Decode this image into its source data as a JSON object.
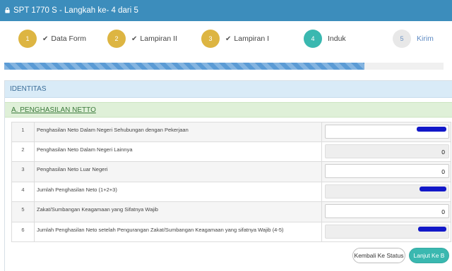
{
  "window": {
    "title": "SPT 1770 S - Langkah ke- 4 dari 5",
    "lock_icon": "lock-icon"
  },
  "steps": [
    {
      "number": "1",
      "label": "Data Form",
      "status": "done"
    },
    {
      "number": "2",
      "label": "Lampiran II",
      "status": "done"
    },
    {
      "number": "3",
      "label": "Lampiran I",
      "status": "done"
    },
    {
      "number": "4",
      "label": "Induk",
      "status": "active"
    },
    {
      "number": "5",
      "label": "Kirim",
      "status": "pending"
    }
  ],
  "step_check_glyph": "✔",
  "progress": {
    "percent": 82,
    "color": "#5b9bd5"
  },
  "panel": {
    "title": "IDENTITAS"
  },
  "section": {
    "title": "A. PENGHASILAN NETTO"
  },
  "rows": [
    {
      "num": "1",
      "label": "Penghasilan Neto Dalam Negeri Sehubungan dengan Pekerjaan",
      "value": "",
      "readonly": false,
      "redacted": true
    },
    {
      "num": "2",
      "label": "Penghasilan Neto Dalam Negeri Lainnya",
      "value": "0",
      "readonly": true,
      "redacted": false
    },
    {
      "num": "3",
      "label": "Penghasilan Neto Luar Negeri",
      "value": "0",
      "readonly": false,
      "redacted": false
    },
    {
      "num": "4",
      "label": "Jumlah Penghasilan Neto (1+2+3)",
      "value": "",
      "readonly": true,
      "redacted": true
    },
    {
      "num": "5",
      "label": "Zakat/Sumbangan Keagamaan yang Sifatnya Wajib",
      "value": "0",
      "readonly": false,
      "redacted": false
    },
    {
      "num": "6",
      "label": "Jumlah Penghasilan Neto setelah Pengurangan Zakat/Sumbangan Keagamaan yang sifatnya Wajib (4-5)",
      "value": "",
      "readonly": true,
      "redacted": true
    }
  ],
  "buttons": {
    "back_label": "Kembali Ke Status",
    "next_label": "Lanjut Ke B"
  },
  "colors": {
    "header": "#3c8dbc",
    "step_done": "#ddb542",
    "step_active": "#3ab8b0",
    "section_bg": "#dff0d8",
    "panel_head_bg": "#d9ebf7",
    "redaction": "#1218c8"
  }
}
